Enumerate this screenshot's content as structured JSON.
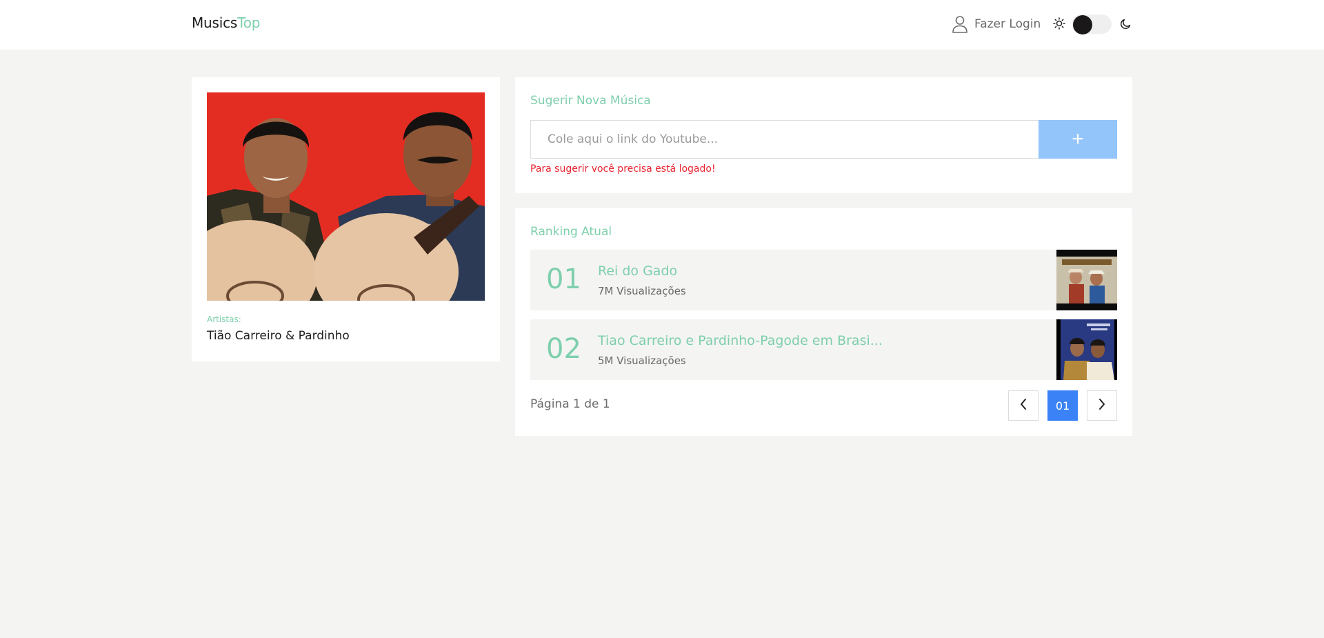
{
  "header": {
    "logo_part1": "Musics",
    "logo_part2": "Top",
    "login_label": "Fazer Login",
    "theme_toggle_state": "light"
  },
  "artist": {
    "label": "Artistas:",
    "name": "Tião Carreiro & Pardinho"
  },
  "suggest": {
    "title": "Sugerir Nova Música",
    "placeholder": "Cole aqui o link do Youtube...",
    "add_label": "+",
    "warning": "Para sugerir você precisa está logado!"
  },
  "ranking": {
    "title": "Ranking Atual",
    "items": [
      {
        "rank": "01",
        "title": "Rei do Gado",
        "views": "7M Visualizações"
      },
      {
        "rank": "02",
        "title": "Tiao Carreiro e Pardinho-Pagode em Brasi...",
        "views": "5M Visualizações"
      }
    ],
    "page_info": "Página 1 de 1",
    "current_page": "01"
  },
  "colors": {
    "accent": "#7ecfac",
    "primary": "#3b82f6",
    "add_button": "#93c5fa",
    "warning": "#e8222f",
    "background": "#f4f4f3"
  }
}
